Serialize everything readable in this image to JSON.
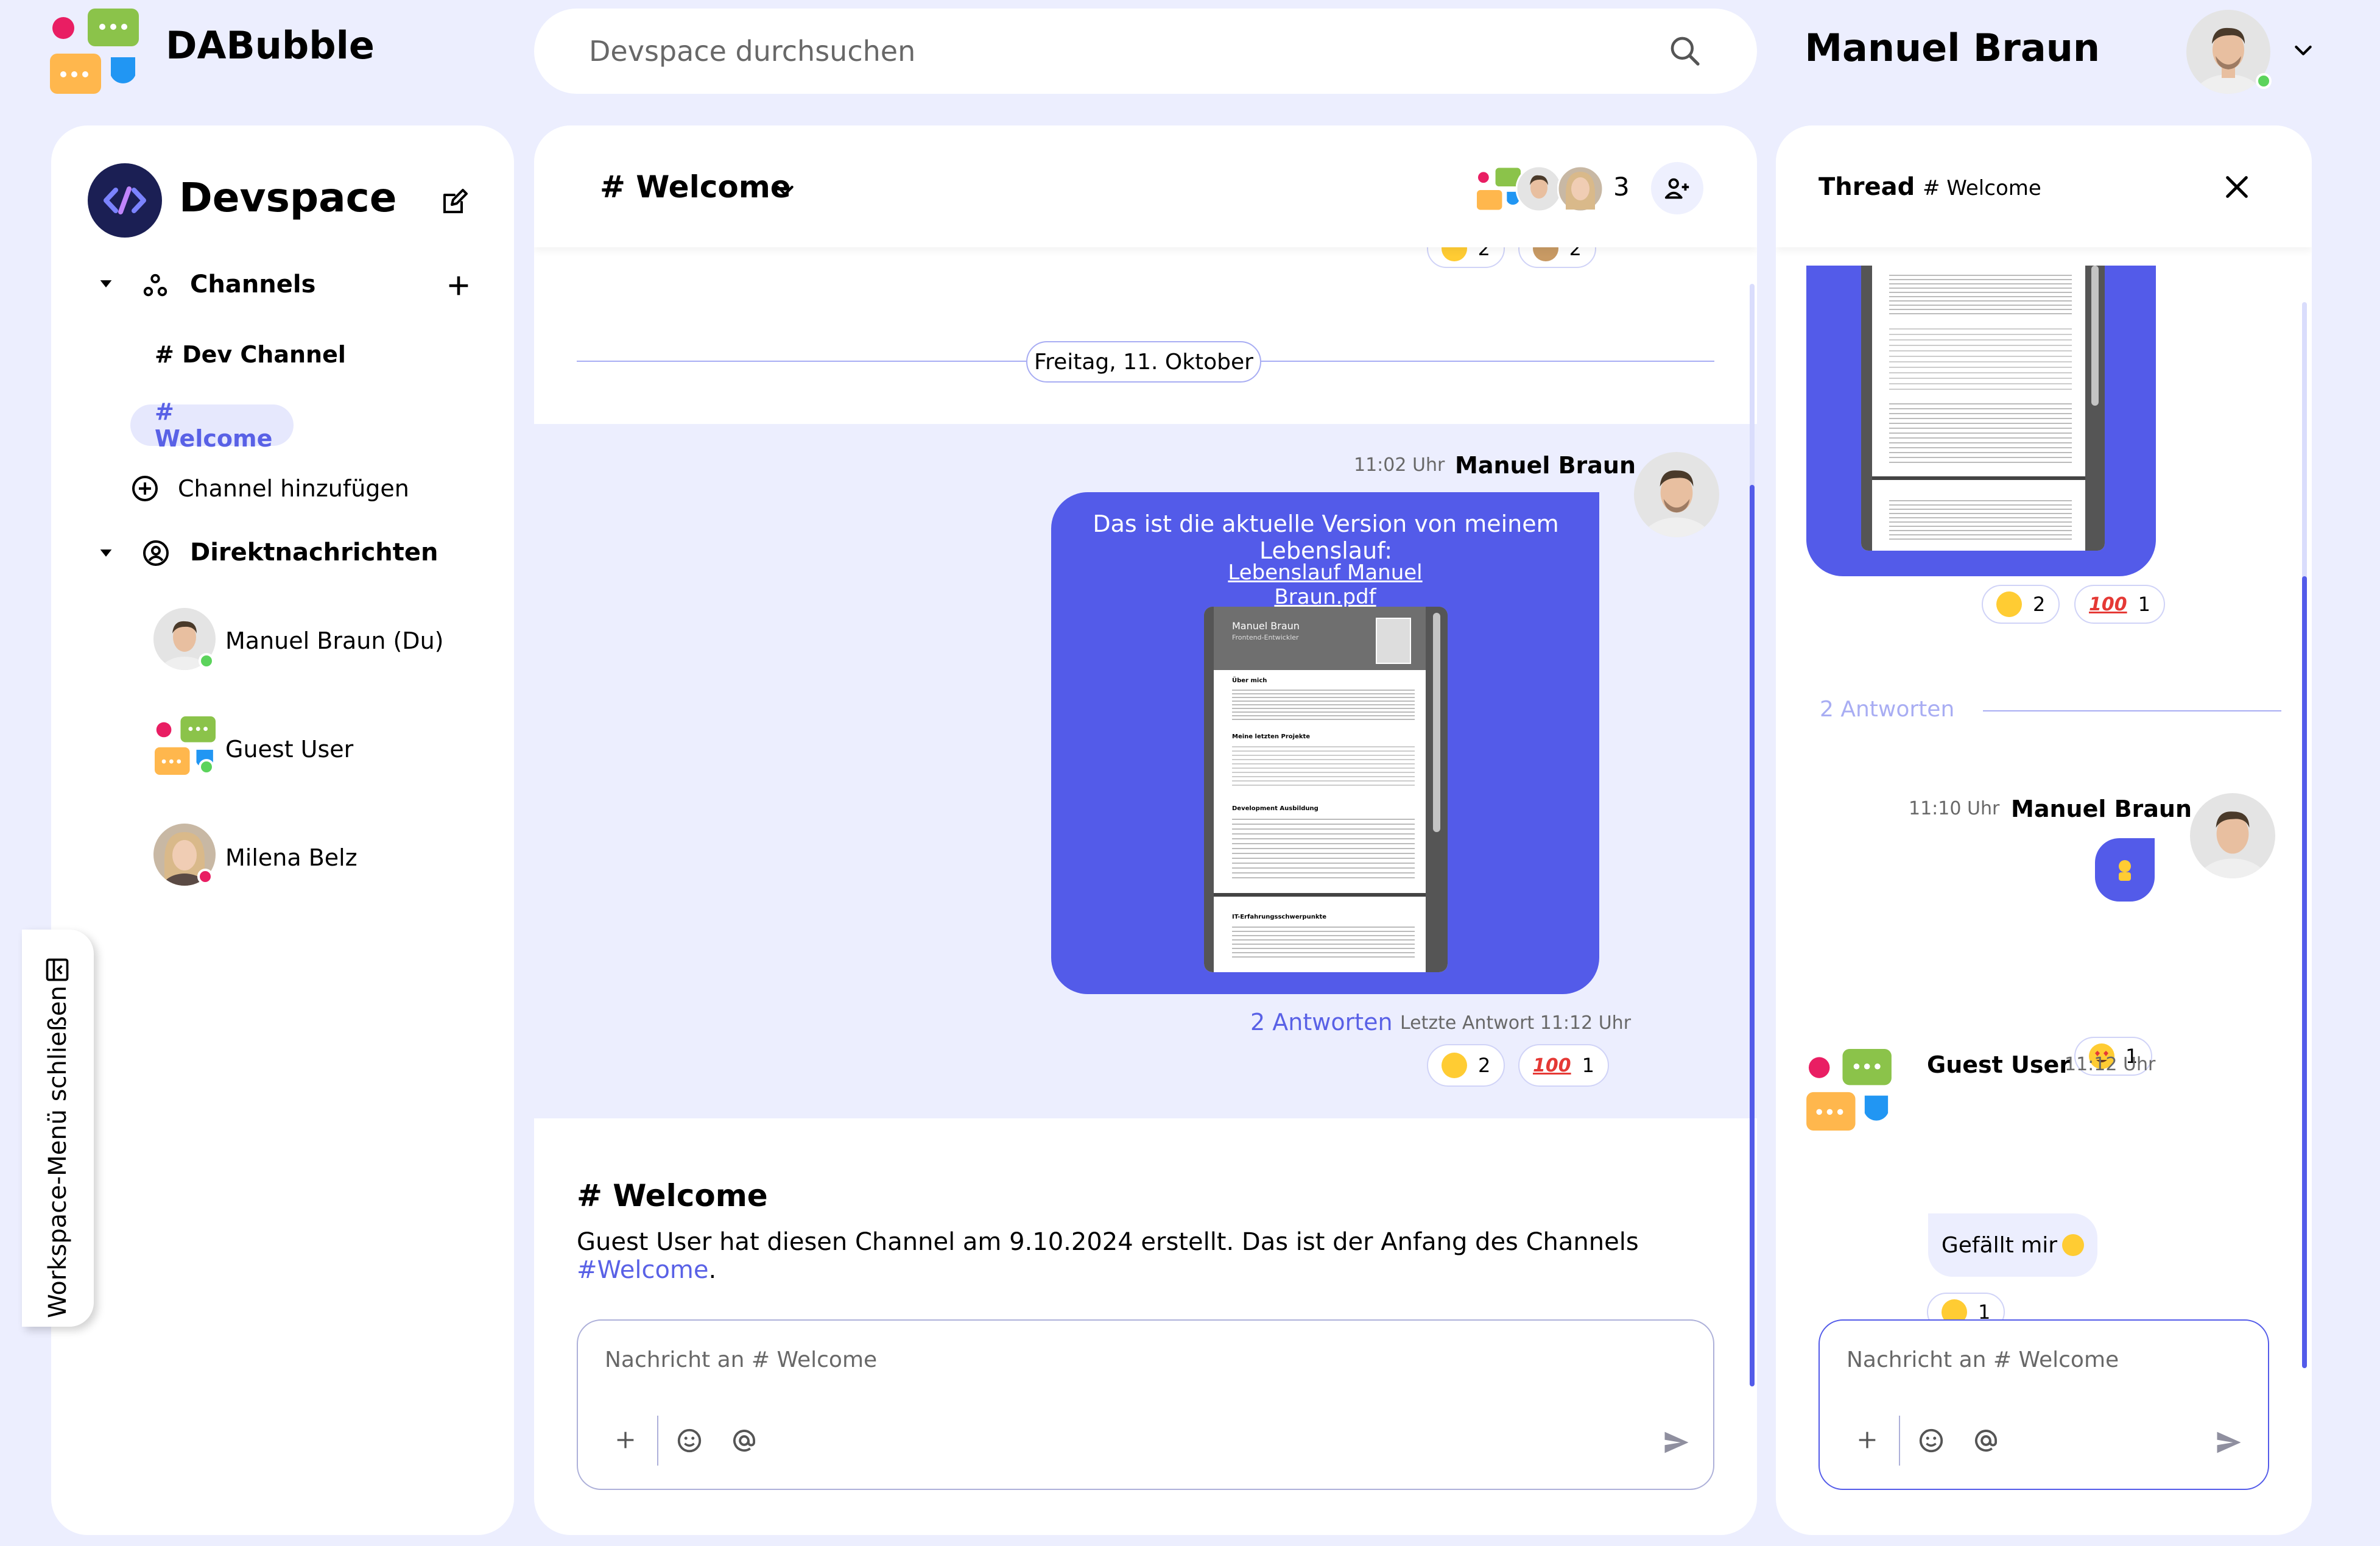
{
  "app": {
    "title": "DABubble",
    "search_placeholder": "Devspace durchsuchen",
    "user_name": "Manuel Braun"
  },
  "sidebar": {
    "workspace_title": "Devspace",
    "channels_label": "Channels",
    "channels": [
      {
        "label": "# Dev Channel",
        "active": false
      },
      {
        "label": "# Welcome",
        "active": true
      }
    ],
    "add_channel_label": "Channel hinzufügen",
    "dm_label": "Direktnachrichten",
    "dms": [
      {
        "name": "Manuel Braun (Du)",
        "status": "online"
      },
      {
        "name": "Guest User",
        "status": "online"
      },
      {
        "name": "Milena Belz",
        "status": "offline"
      }
    ],
    "workspace_toggle_label": "Workspace-Menü schließen"
  },
  "channel": {
    "title": "# Welcome",
    "member_count": "3",
    "top_reactions": [
      {
        "count": "2"
      },
      {
        "count": "2"
      }
    ],
    "date_separator": "Freitag, 11. Oktober",
    "message": {
      "time": "11:02 Uhr",
      "author": "Manuel Braun",
      "text": "Das ist die aktuelle Version von meinem Lebenslauf:",
      "attachment_link": "Lebenslauf Manuel Braun.pdf",
      "replies_label": "2 Antworten",
      "last_reply": "Letzte Antwort 11:12 Uhr",
      "reactions": [
        {
          "emoji": "smile",
          "count": "2"
        },
        {
          "emoji": "100",
          "count": "1"
        }
      ]
    },
    "intro_title": "# Welcome",
    "intro_text": "Guest User hat diesen Channel am 9.10.2024 erstellt. Das ist der Anfang des Channels ",
    "intro_link": "#Welcome",
    "intro_end": ".",
    "input_placeholder": "Nachricht an # Welcome"
  },
  "thread": {
    "title_bold": "Thread",
    "title_channel": "# Welcome",
    "top_reactions": [
      {
        "emoji": "smile",
        "count": "2"
      },
      {
        "emoji": "100",
        "count": "1"
      }
    ],
    "replies_label": "2 Antworten",
    "reply1": {
      "time": "11:10 Uhr",
      "author": "Manuel Braun",
      "reaction_count": "1"
    },
    "reply2": {
      "author": "Guest User",
      "time": "11:12 Uhr",
      "text": "Gefällt mir",
      "reaction_count": "1"
    },
    "input_placeholder": "Nachricht an # Welcome"
  },
  "pdf": {
    "name": "Manuel Braun",
    "subtitle": "Frontend-Entwickler",
    "section1": "Über mich",
    "section2": "Meine letzten Projekte",
    "section3": "Development Ausbildung",
    "section4": "IT-Erfahrungsschwerpunkte"
  },
  "colors": {
    "accent": "#535BE9",
    "background": "#ECEEFE",
    "online": "#5BD35B",
    "offline": "#E91E63"
  }
}
